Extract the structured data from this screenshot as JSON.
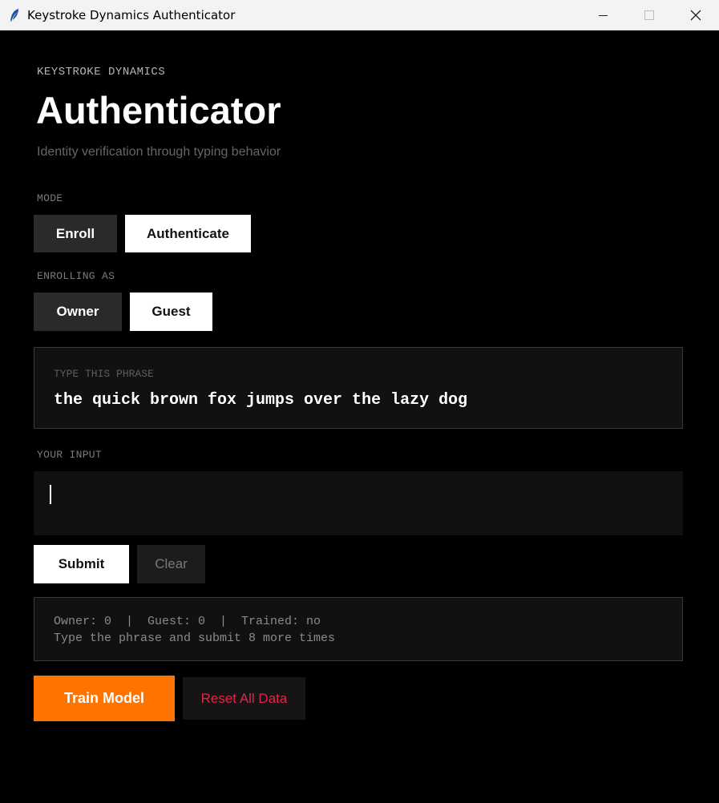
{
  "window": {
    "title": "Keystroke Dynamics Authenticator",
    "app_icon": "feather-icon",
    "controls": {
      "minimize_icon": "minimize-icon",
      "maximize_icon": "maximize-icon",
      "close_icon": "close-icon"
    }
  },
  "header": {
    "eyebrow": "KEYSTROKE DYNAMICS",
    "title": "Authenticator",
    "subtitle": "Identity verification through typing behavior"
  },
  "mode": {
    "label": "MODE",
    "options": [
      "Enroll",
      "Authenticate"
    ],
    "selected": "Authenticate"
  },
  "enrolling_as": {
    "label": "ENROLLING AS",
    "options": [
      "Owner",
      "Guest"
    ],
    "selected": "Guest"
  },
  "phrase": {
    "label": "TYPE THIS PHRASE",
    "text": "the quick brown fox jumps over the lazy dog"
  },
  "input": {
    "label": "YOUR INPUT",
    "value": ""
  },
  "actions": {
    "submit": "Submit",
    "clear": "Clear"
  },
  "status": {
    "counts": "Owner: 0  |  Guest: 0  |  Trained: no",
    "message": "Type the phrase and submit 8 more times"
  },
  "footer": {
    "train": "Train Model",
    "reset": "Reset All Data"
  },
  "colors": {
    "background": "#000000",
    "accent": "#ff7300",
    "danger": "#e0264a"
  }
}
